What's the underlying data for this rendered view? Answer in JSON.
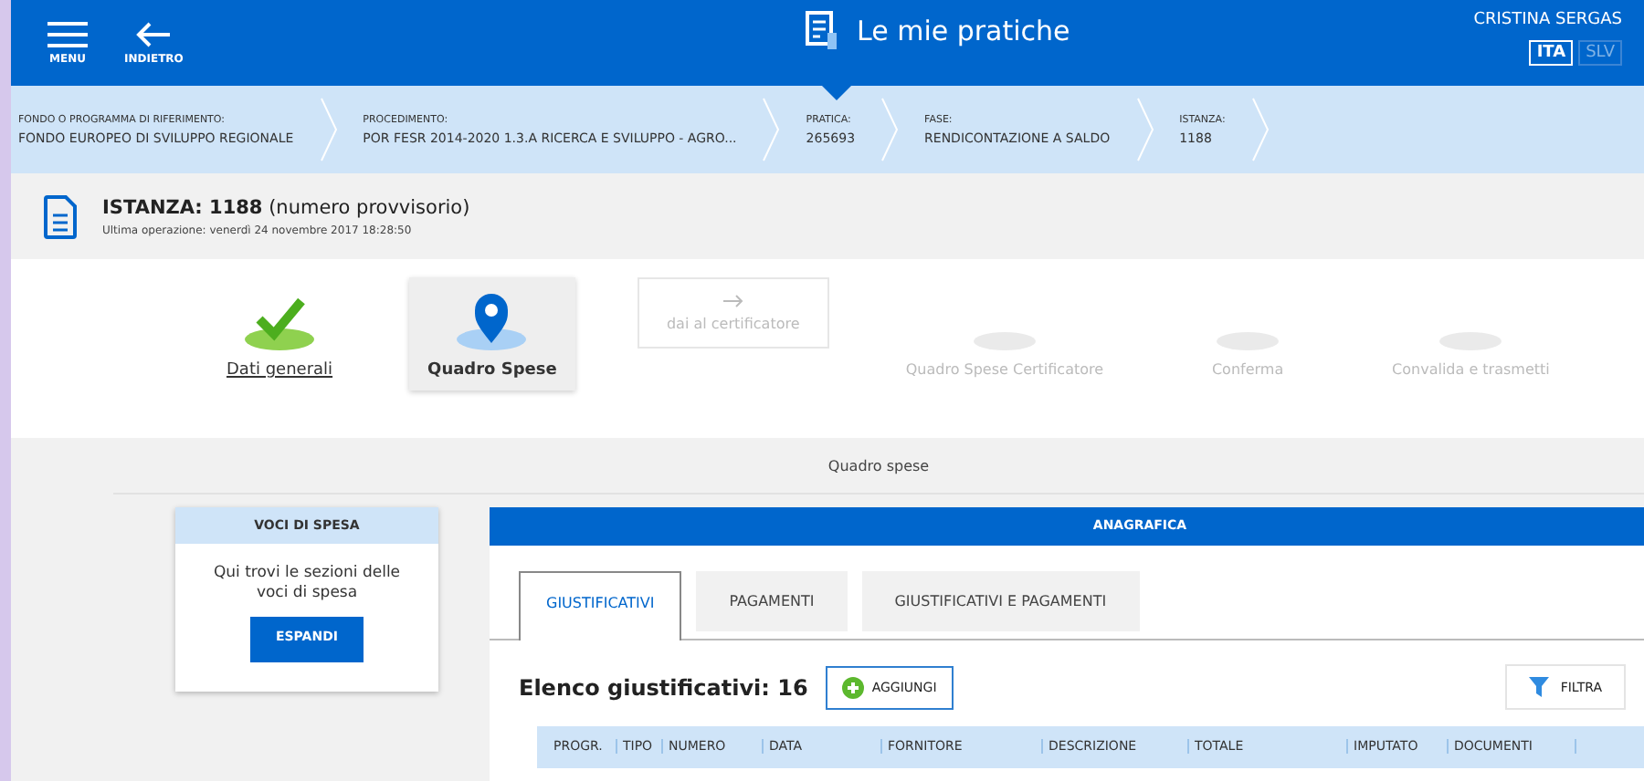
{
  "header": {
    "menu_label": "MENU",
    "back_label": "INDIETRO",
    "title": "Le mie pratiche",
    "user": "CRISTINA SERGAS",
    "languages": [
      {
        "label": "ITA",
        "selected": true
      },
      {
        "label": "SLV",
        "selected": false
      }
    ]
  },
  "breadcrumb": [
    {
      "label": "FONDO O PROGRAMMA DI RIFERIMENTO:",
      "value": "FONDO EUROPEO DI SVILUPPO REGIONALE"
    },
    {
      "label": "PROCEDIMENTO:",
      "value": "POR FESR 2014-2020 1.3.A RICERCA E SVILUPPO - AGRO..."
    },
    {
      "label": "PRATICA:",
      "value": "265693"
    },
    {
      "label": "FASE:",
      "value": "RENDICONTAZIONE A SALDO"
    },
    {
      "label": "ISTANZA:",
      "value": "1188"
    }
  ],
  "instance": {
    "title": "ISTANZA: 1188",
    "note": "(numero provvisorio)",
    "last_operation": "Ultima operazione: venerdì 24 novembre 2017 18:28:50"
  },
  "steps": [
    {
      "kind": "done",
      "label": "Dati generali",
      "selected": false
    },
    {
      "kind": "current",
      "label": "Quadro Spese",
      "selected": true
    },
    {
      "kind": "action",
      "label": "dai al certificatore",
      "selected": false
    },
    {
      "kind": "pending",
      "label": "Quadro Spese Certificatore",
      "selected": false
    },
    {
      "kind": "pending",
      "label": "Conferma",
      "selected": false
    },
    {
      "kind": "pending",
      "label": "Convalida e trasmetti",
      "selected": false
    }
  ],
  "section_title": "Quadro spese",
  "voci_panel": {
    "title": "VOCI DI SPESA",
    "text": "Qui trovi le sezioni delle voci di spesa",
    "button": "ESPANDI"
  },
  "anagrafica": {
    "title": "ANAGRAFICA",
    "tabs": [
      {
        "label": "GIUSTIFICATIVI",
        "selected": true
      },
      {
        "label": "PAGAMENTI",
        "selected": false
      },
      {
        "label": "GIUSTIFICATIVI E PAGAMENTI",
        "selected": false
      }
    ],
    "list_title": "Elenco giustificativi: 16",
    "add_button": "AGGIUNGI",
    "filter_button": "FILTRA",
    "columns": [
      "PROGR.",
      "TIPO",
      "NUMERO",
      "DATA",
      "FORNITORE",
      "DESCRIZIONE",
      "TOTALE",
      "IMPUTATO",
      "DOCUMENTI"
    ]
  }
}
